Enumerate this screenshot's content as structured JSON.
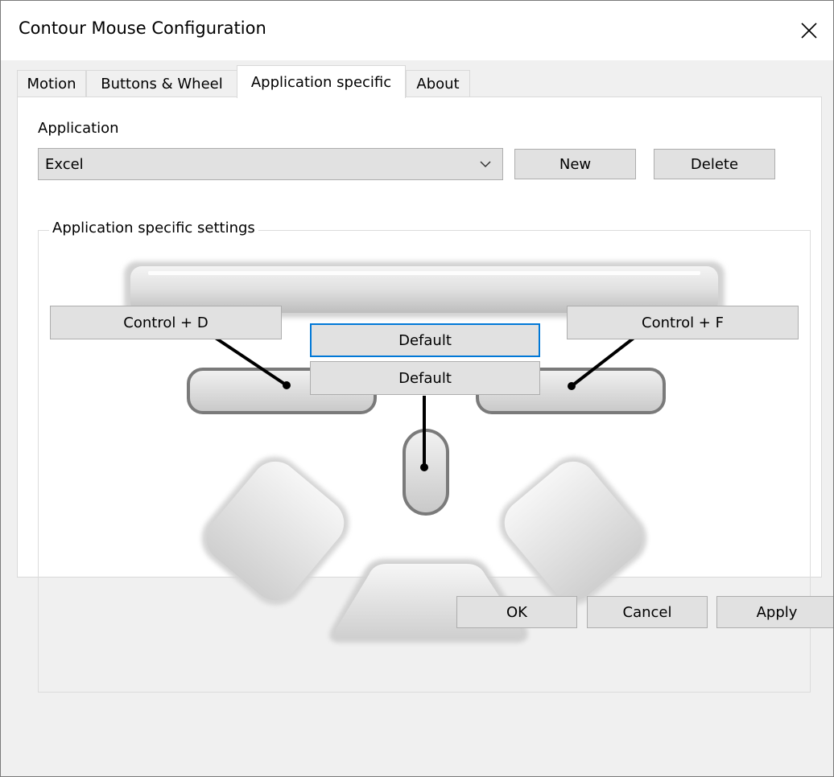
{
  "window": {
    "title": "Contour Mouse Configuration"
  },
  "tabs": [
    {
      "label": "Motion",
      "active": false
    },
    {
      "label": "Buttons & Wheel",
      "active": false
    },
    {
      "label": "Application specific",
      "active": true
    },
    {
      "label": "About",
      "active": false
    }
  ],
  "application": {
    "label": "Application",
    "selected": "Excel",
    "new_label": "New",
    "delete_label": "Delete"
  },
  "settings": {
    "group_label": "Application specific settings",
    "left_button": "Control + D",
    "right_button": "Control + F",
    "wheel_up": "Default",
    "wheel_click": "Default"
  },
  "footer": {
    "ok_label": "OK",
    "cancel_label": "Cancel",
    "apply_label": "Apply"
  },
  "colors": {
    "focus_accent": "#0078d7",
    "button_face": "#e1e1e1",
    "button_border": "#adadad"
  }
}
